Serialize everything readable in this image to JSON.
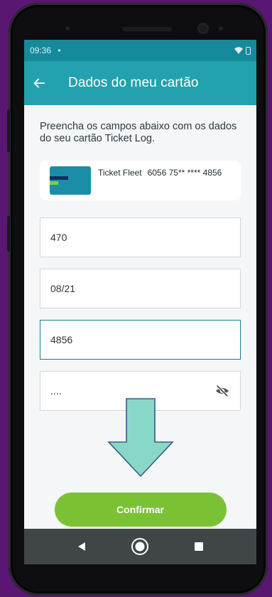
{
  "statusbar": {
    "time": "09:36",
    "dot": "•"
  },
  "appbar": {
    "title": "Dados do meu cartão"
  },
  "content": {
    "instructions": "Preencha os campos abaixo com os dados do seu cartão Ticket Log.",
    "card": {
      "name": "Ticket Fleet",
      "number": "6056 75** **** 4856"
    }
  },
  "fields": {
    "f1": {
      "value": "470"
    },
    "f2": {
      "value": "08/21"
    },
    "f3": {
      "value": "4856"
    },
    "f4": {
      "value": "...."
    }
  },
  "confirm": {
    "label": "Confirmar"
  },
  "colors": {
    "appbar": "#23a1ae",
    "statusbar": "#168a9a",
    "confirm": "#7ac234",
    "arrow_fill": "#88d8c8",
    "arrow_stroke": "#3a5a8a"
  },
  "icons": {
    "back": "arrow-left",
    "visibility": "eye-off",
    "nav": [
      "triangle-back",
      "circle-home",
      "square-recents"
    ]
  }
}
